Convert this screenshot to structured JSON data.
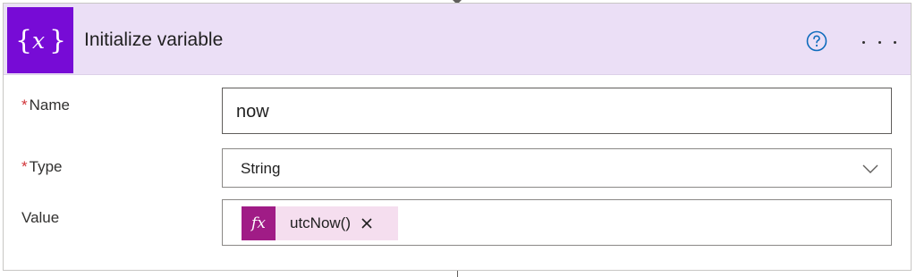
{
  "action": {
    "title": "Initialize variable",
    "icon": "variable-braces-icon",
    "icon_glyph_left": "{",
    "icon_glyph_var": "x",
    "icon_glyph_right": "}",
    "accent_color": "#770bd6",
    "header_bg": "#ebdff6"
  },
  "fields": {
    "name": {
      "required_mark": "*",
      "label": "Name",
      "value": "now"
    },
    "type": {
      "required_mark": "*",
      "label": "Type",
      "value": "String"
    },
    "value": {
      "label": "Value",
      "token": {
        "icon_text": "fx",
        "text": "utcNow()",
        "color": "#a01c86"
      }
    }
  }
}
